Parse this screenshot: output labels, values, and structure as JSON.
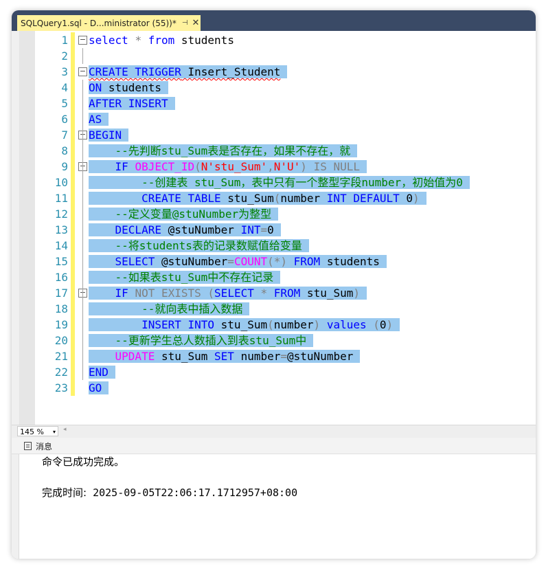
{
  "tab": {
    "title": "SQLQuery1.sql - D...ministrator (55))*",
    "pin": "⊣",
    "close": "✕"
  },
  "editor": {
    "lines": [
      {
        "n": "1",
        "tokens": [
          [
            "k",
            "select"
          ],
          [
            "t",
            " "
          ],
          [
            "g",
            "*"
          ],
          [
            "t",
            " "
          ],
          [
            "k",
            "from"
          ],
          [
            "t",
            " students"
          ]
        ]
      },
      {
        "n": "2",
        "tokens": []
      },
      {
        "n": "3",
        "tokens": [
          [
            "k",
            "CREATE TRIGGER"
          ],
          [
            "t",
            " Insert_Student"
          ]
        ]
      },
      {
        "n": "4",
        "tokens": [
          [
            "k",
            "ON"
          ],
          [
            "t",
            " students"
          ]
        ]
      },
      {
        "n": "5",
        "tokens": [
          [
            "k",
            "AFTER INSERT"
          ]
        ]
      },
      {
        "n": "6",
        "tokens": [
          [
            "k",
            "AS"
          ]
        ]
      },
      {
        "n": "7",
        "tokens": [
          [
            "k",
            "BEGIN"
          ]
        ]
      },
      {
        "n": "8",
        "tokens": [
          [
            "t",
            "    "
          ],
          [
            "c",
            "--先判断stu_Sum表是否存在，如果不存在，就"
          ]
        ]
      },
      {
        "n": "9",
        "tokens": [
          [
            "t",
            "    "
          ],
          [
            "k",
            "IF"
          ],
          [
            "t",
            " "
          ],
          [
            "p",
            "OBJECT_ID"
          ],
          [
            "g",
            "("
          ],
          [
            "s",
            "N'stu_Sum'"
          ],
          [
            "g",
            ","
          ],
          [
            "s",
            "N'U'"
          ],
          [
            "g",
            ")"
          ],
          [
            "t",
            " "
          ],
          [
            "g",
            "IS NULL"
          ]
        ]
      },
      {
        "n": "10",
        "tokens": [
          [
            "t",
            "        "
          ],
          [
            "c",
            "--创建表 stu_Sum，表中只有一个整型字段number，初始值为0"
          ]
        ]
      },
      {
        "n": "11",
        "tokens": [
          [
            "t",
            "        "
          ],
          [
            "k",
            "CREATE TABLE"
          ],
          [
            "t",
            " stu_Sum"
          ],
          [
            "g",
            "("
          ],
          [
            "t",
            "number "
          ],
          [
            "k",
            "INT DEFAULT"
          ],
          [
            "t",
            " 0"
          ],
          [
            "g",
            ")"
          ]
        ]
      },
      {
        "n": "12",
        "tokens": [
          [
            "t",
            "    "
          ],
          [
            "c",
            "--定义变量@stuNumber为整型"
          ]
        ]
      },
      {
        "n": "13",
        "tokens": [
          [
            "t",
            "    "
          ],
          [
            "k",
            "DECLARE"
          ],
          [
            "t",
            " @stuNumber "
          ],
          [
            "k",
            "INT"
          ],
          [
            "g",
            "="
          ],
          [
            "t",
            "0"
          ]
        ]
      },
      {
        "n": "14",
        "tokens": [
          [
            "t",
            "    "
          ],
          [
            "c",
            "--将students表的记录数赋值给变量"
          ]
        ]
      },
      {
        "n": "15",
        "tokens": [
          [
            "t",
            "    "
          ],
          [
            "k",
            "SELECT"
          ],
          [
            "t",
            " @stuNumber"
          ],
          [
            "g",
            "="
          ],
          [
            "p",
            "COUNT"
          ],
          [
            "g",
            "(*)"
          ],
          [
            "t",
            " "
          ],
          [
            "k",
            "FROM"
          ],
          [
            "t",
            " students"
          ]
        ]
      },
      {
        "n": "16",
        "tokens": [
          [
            "t",
            "    "
          ],
          [
            "c",
            "--如果表stu_Sum中不存在记录"
          ]
        ]
      },
      {
        "n": "17",
        "tokens": [
          [
            "t",
            "    "
          ],
          [
            "k",
            "IF"
          ],
          [
            "t",
            " "
          ],
          [
            "g",
            "NOT EXISTS"
          ],
          [
            "t",
            " "
          ],
          [
            "g",
            "("
          ],
          [
            "k",
            "SELECT"
          ],
          [
            "t",
            " "
          ],
          [
            "g",
            "*"
          ],
          [
            "t",
            " "
          ],
          [
            "k",
            "FROM"
          ],
          [
            "t",
            " stu_Sum"
          ],
          [
            "g",
            ")"
          ]
        ]
      },
      {
        "n": "18",
        "tokens": [
          [
            "t",
            "        "
          ],
          [
            "c",
            "--就向表中插入数据"
          ]
        ]
      },
      {
        "n": "19",
        "tokens": [
          [
            "t",
            "        "
          ],
          [
            "k",
            "INSERT INTO"
          ],
          [
            "t",
            " stu_Sum"
          ],
          [
            "g",
            "("
          ],
          [
            "t",
            "number"
          ],
          [
            "g",
            ")"
          ],
          [
            "t",
            " "
          ],
          [
            "k",
            "values"
          ],
          [
            "t",
            " "
          ],
          [
            "g",
            "("
          ],
          [
            "t",
            "0"
          ],
          [
            "g",
            ")"
          ]
        ]
      },
      {
        "n": "20",
        "tokens": [
          [
            "t",
            "    "
          ],
          [
            "c",
            "--更新学生总人数插入到表stu_Sum中"
          ]
        ]
      },
      {
        "n": "21",
        "tokens": [
          [
            "t",
            "    "
          ],
          [
            "p",
            "UPDATE"
          ],
          [
            "t",
            " stu_Sum "
          ],
          [
            "k",
            "SET"
          ],
          [
            "t",
            " number"
          ],
          [
            "g",
            "="
          ],
          [
            "t",
            "@stuNumber"
          ]
        ]
      },
      {
        "n": "22",
        "tokens": [
          [
            "k",
            "END"
          ]
        ]
      },
      {
        "n": "23",
        "tokens": [
          [
            "k",
            "GO"
          ]
        ]
      }
    ]
  },
  "status": {
    "zoom": "145 %",
    "zoom_arrow": "▾",
    "scroll_left": "◂"
  },
  "results": {
    "tab_label": "消息",
    "message": "命令已成功完成。",
    "completion_label": "完成时间:",
    "completion_time": " 2025-09-05T22:06:17.1712957+08:00"
  },
  "colors": {
    "keyword": "#0000ff",
    "comment": "#008000",
    "string": "#ff0000",
    "function": "#ff00ff",
    "operator": "#808080",
    "selection": "#99c9ef",
    "tab": "#fff29d",
    "linenumber": "#2b91af"
  }
}
